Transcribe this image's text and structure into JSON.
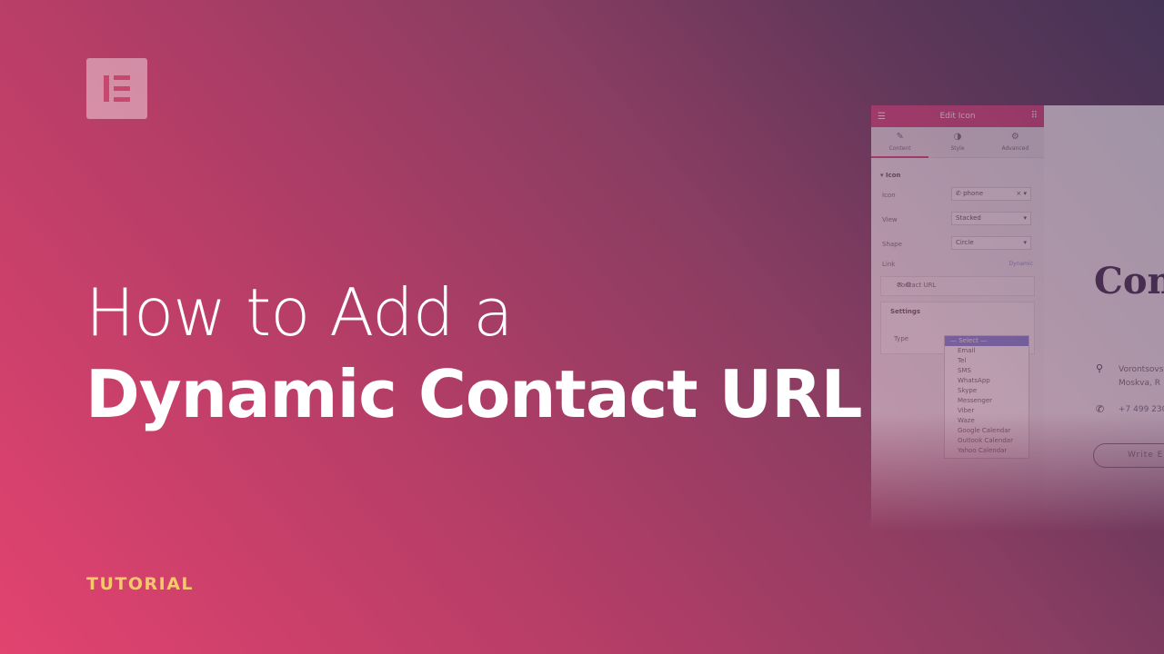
{
  "brand": {
    "logo_name": "elementor-logo",
    "bg_start": "#e2436f",
    "bg_end": "#443356",
    "accent": "#f4c86b"
  },
  "headline": {
    "line1": "How to Add a",
    "line2": "Dynamic Contact URL"
  },
  "tag": "TUTORIAL",
  "editor": {
    "title": "Edit Icon",
    "tabs": [
      {
        "label": "Content",
        "icon": "pencil-icon"
      },
      {
        "label": "Style",
        "icon": "half-circle-icon"
      },
      {
        "label": "Advanced",
        "icon": "gear-icon"
      }
    ],
    "section": "Icon",
    "fields": [
      {
        "label": "Icon",
        "value": "phone"
      },
      {
        "label": "View",
        "value": "Stacked"
      },
      {
        "label": "Shape",
        "value": "Circle"
      }
    ],
    "link_label": "Link",
    "dynamic_label": "Dynamic",
    "link_value": "Contact URL",
    "settings_title": "Settings",
    "type_label": "Type",
    "type_options": [
      "— Select —",
      "Email",
      "Tel",
      "SMS",
      "WhatsApp",
      "Skype",
      "Messenger",
      "Viber",
      "Waze",
      "Google Calendar",
      "Outlook Calendar",
      "Yahoo Calendar"
    ]
  },
  "preview": {
    "title": "Con",
    "address_line1": "Vorontsovs",
    "address_line2": "Moskva, R",
    "phone": "+7 499 230",
    "button": "Write E"
  }
}
